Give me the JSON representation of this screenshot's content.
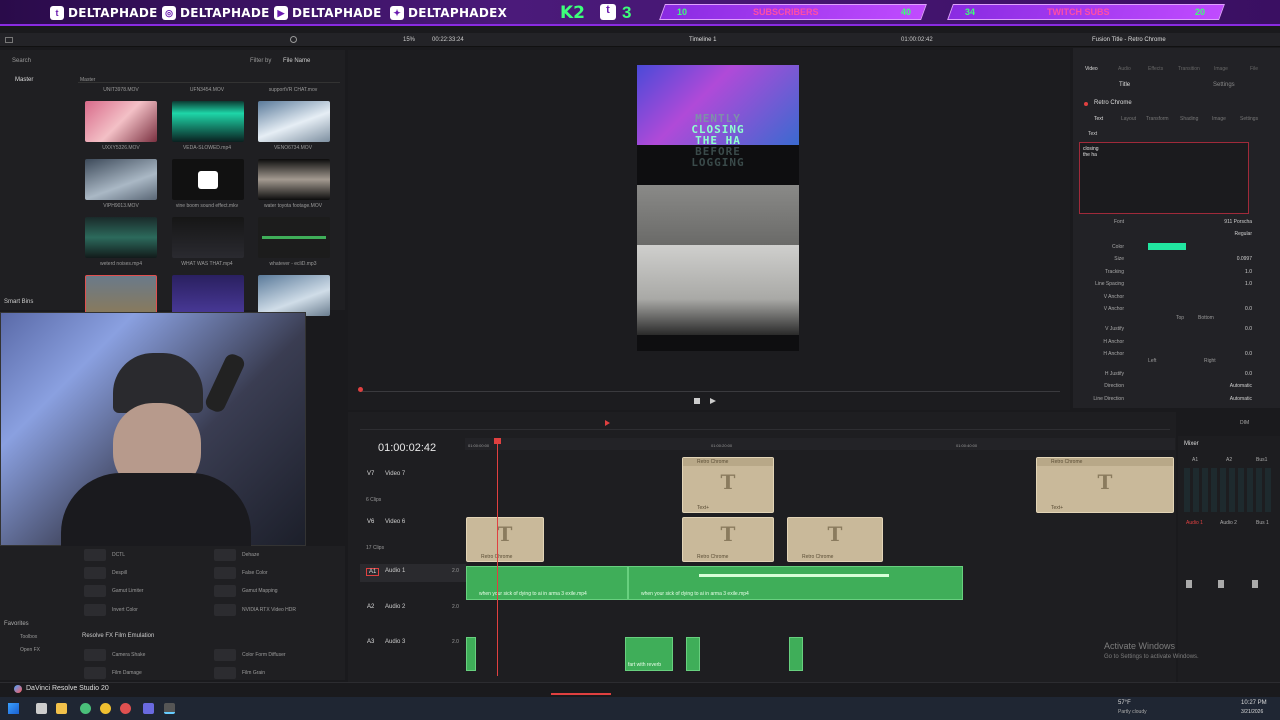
{
  "banner": {
    "socials": [
      "DELTAPHADE",
      "DELTAPHADE",
      "DELTAPHADE",
      "DELTAPHADEX"
    ],
    "brand": "K2",
    "goal1": {
      "current": "10",
      "label": "SUBSCRIBERS",
      "target": "40"
    },
    "goal2": {
      "current": "34",
      "label": "TWITCH SUBS",
      "target": "20"
    }
  },
  "toolbar": {
    "zoom": "15%",
    "timecode": "00:22:33:24",
    "timeline_name": "Timeline 1",
    "source_tc": "01:00:02:42",
    "inspector_title": "Fusion Title - Retro Chrome"
  },
  "media": {
    "search_label": "Search",
    "filter_label": "Filter by",
    "filter_value": "File Name",
    "master": "Master",
    "bin_master": "Master",
    "smart_bins": "Smart Bins",
    "clips": [
      {
        "name": "UXXY5326.MOV"
      },
      {
        "name": "VEDA-SLOWED.mp4"
      },
      {
        "name": "VENO6734.MOV"
      },
      {
        "name": "VIPH9013.MOV"
      },
      {
        "name": "vine boom sound effect.mkv"
      },
      {
        "name": "water toyota footage.MOV"
      },
      {
        "name": "weterd noises.mp4"
      },
      {
        "name": "WHAT WAS THAT.mp4"
      },
      {
        "name": "whatever - ecliD.mp3"
      },
      {
        "name": ""
      },
      {
        "name": ""
      },
      {
        "name": ""
      }
    ],
    "top_labels": [
      "UNIT3978.MOV",
      "UFN3454.MOV",
      "supportVR CHAT.mov"
    ]
  },
  "effects": {
    "rows": [
      {
        "a": "DCTL",
        "b": "Dehaze"
      },
      {
        "a": "Despill",
        "b": "False Color"
      },
      {
        "a": "Gamut Limiter",
        "b": "Gamut Mapping"
      },
      {
        "a": "Invert Color",
        "b": "NVIDIA RTX Video HDR"
      }
    ],
    "section": "Resolve FX Film Emulation",
    "rows2": [
      {
        "a": "Camera Shake",
        "b": "Color Form Diffuser"
      },
      {
        "a": "Film Damage",
        "b": "Film Grain"
      }
    ],
    "favorites": "Favorites",
    "toolbox": "Toolbox",
    "openfx": "Open FX"
  },
  "preview": {
    "overlay_lines": [
      "MENTLY",
      "CLOSING",
      "THE HA",
      "BEFORE",
      "LOGGING"
    ]
  },
  "inspector": {
    "tabs": [
      "Video",
      "Audio",
      "Effects",
      "Transition",
      "Image",
      "File"
    ],
    "subtabs": [
      "Title",
      "Settings"
    ],
    "node_name": "Retro Chrome",
    "text_tabs": [
      "Text",
      "Layout",
      "Transform",
      "Shading",
      "Image",
      "Settings"
    ],
    "section": "Text",
    "text_value": "closing\nthe ha",
    "rows": [
      {
        "k": "Font",
        "v": "911 Porscha"
      },
      {
        "k": "",
        "v": "Regular"
      },
      {
        "k": "Color",
        "v": ""
      },
      {
        "k": "Size",
        "v": "0.0997"
      },
      {
        "k": "Tracking",
        "v": "1.0"
      },
      {
        "k": "Line Spacing",
        "v": "1.0"
      },
      {
        "k": "V Anchor",
        "v": ""
      },
      {
        "k": "V Anchor",
        "v": "0.0"
      },
      {
        "k": "V Justify",
        "v": "0.0"
      },
      {
        "k": "H Anchor",
        "v": ""
      },
      {
        "k": "H Anchor",
        "v": "0.0"
      },
      {
        "k": "H Justify",
        "v": "0.0"
      },
      {
        "k": "Direction",
        "v": "Automatic"
      },
      {
        "k": "Line Direction",
        "v": "Automatic"
      }
    ],
    "top_label": "Top",
    "bottom_label": "Bottom",
    "left_label": "Left",
    "right_label": "Right",
    "color_hex": "#21e6a0"
  },
  "timeline": {
    "timecode": "01:00:02:42",
    "ruler": [
      "01:00:00:00",
      "01:00:20:00",
      "01:00:40:00"
    ],
    "tracks": [
      {
        "id": "V7",
        "name": "Video 7",
        "clips": ""
      },
      {
        "id": "V6",
        "name": "Video 6",
        "clips": "6 Clips"
      },
      {
        "id": "",
        "name": "",
        "clips": "17 Clips"
      },
      {
        "id": "A1",
        "name": "Audio 1",
        "level": "2.0"
      },
      {
        "id": "A2",
        "name": "Audio 2",
        "level": "2.0"
      },
      {
        "id": "A3",
        "name": "Audio 3",
        "level": "2.0"
      }
    ],
    "title_clip_header": "Retro Chrome",
    "title_clip_footer": "Text+",
    "audio_clip": "when your sick of dying to ai in arma 3 exile.mp4",
    "fart_clip": "fart with reverb"
  },
  "mixer": {
    "title": "Mixer",
    "channels": [
      "A1",
      "A2",
      "Bus1"
    ],
    "channel_labels": [
      "Audio 1",
      "Audio 2",
      "Bus 1"
    ],
    "dim": "DIM"
  },
  "watermark": {
    "line1": "Activate Windows",
    "line2": "Go to Settings to activate Windows."
  },
  "footer": {
    "app": "DaVinci Resolve Studio 20"
  },
  "taskbar": {
    "weather": "57°F",
    "weather_sub": "Partly cloudy",
    "time": "10:27 PM",
    "date": "3/21/2026"
  }
}
